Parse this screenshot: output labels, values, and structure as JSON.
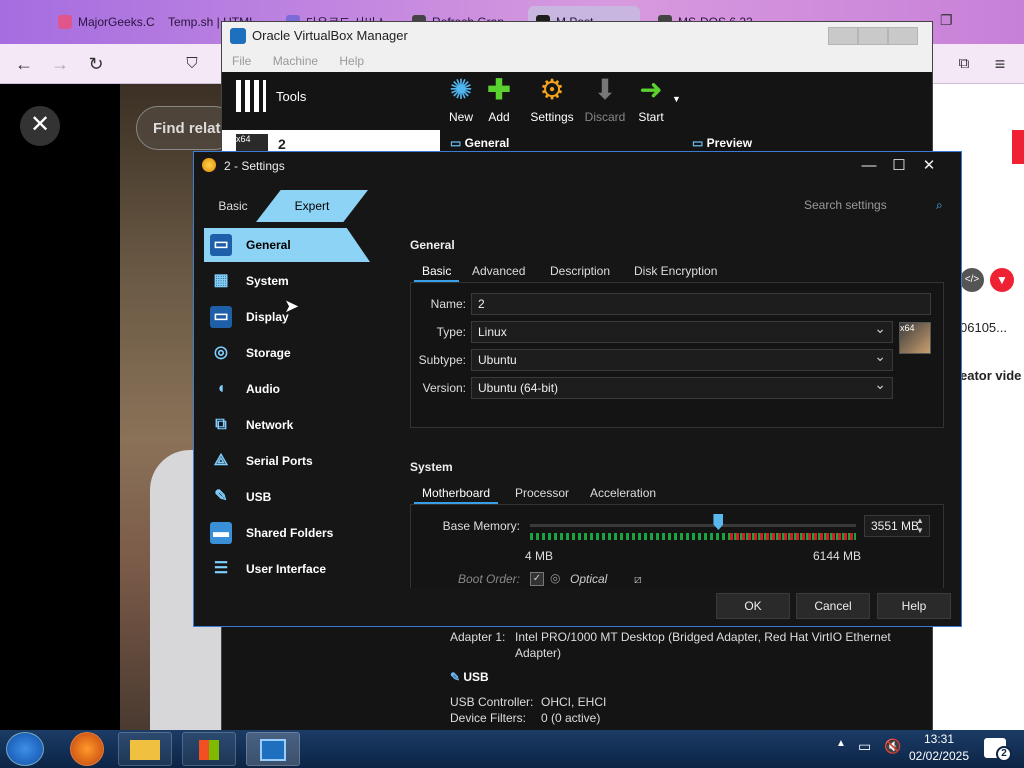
{
  "browser": {
    "tabs": [
      {
        "label": "MajorGeeks.C",
        "color": "#e0558c"
      },
      {
        "label": "Temp.sh | HTML",
        "color": "#666666"
      },
      {
        "label": "다운로드 서비스",
        "color": "#7b6bd6"
      },
      {
        "label": "Refresh Grap",
        "color": "#444444"
      },
      {
        "label": "M Post",
        "color": "#1e1e1e"
      },
      {
        "label": "MS-DOS 6.22",
        "color": "#444444"
      }
    ],
    "video_find_label": "Find relat",
    "right_snippets": {
      "id_text": "06105...",
      "creator": "eator vide"
    }
  },
  "vbm": {
    "title": "Oracle VirtualBox Manager",
    "menu": [
      "File",
      "Machine",
      "Help"
    ],
    "tools_label": "Tools",
    "toolbar": [
      {
        "label": "New",
        "icon": "new-icon"
      },
      {
        "label": "Add",
        "icon": "add-icon"
      },
      {
        "label": "Settings",
        "icon": "settings-icon"
      },
      {
        "label": "Discard",
        "icon": "discard-icon"
      },
      {
        "label": "Start",
        "icon": "start-icon"
      }
    ],
    "vm_name": "2",
    "sections": {
      "general": "General",
      "preview": "Preview",
      "usb": "USB"
    },
    "adapter_label": "Adapter 1:",
    "adapter_value_1": "Intel PRO/1000 MT Desktop (Bridged Adapter, Red Hat VirtIO Ethernet",
    "adapter_value_2": "Adapter)",
    "usb_controller_label": "USB Controller:",
    "usb_controller_value": "OHCI, EHCI",
    "device_filters_label": "Device Filters:",
    "device_filters_value": "0 (0 active)"
  },
  "settings": {
    "title": "2 - Settings",
    "mode_basic": "Basic",
    "mode_expert": "Expert",
    "search_placeholder": "Search settings",
    "nav": [
      {
        "label": "General",
        "icon": "general-icon",
        "selected": true
      },
      {
        "label": "System",
        "icon": "system-icon"
      },
      {
        "label": "Display",
        "icon": "display-icon"
      },
      {
        "label": "Storage",
        "icon": "storage-icon"
      },
      {
        "label": "Audio",
        "icon": "audio-icon"
      },
      {
        "label": "Network",
        "icon": "network-icon"
      },
      {
        "label": "Serial Ports",
        "icon": "serial-ports-icon"
      },
      {
        "label": "USB",
        "icon": "usb-icon"
      },
      {
        "label": "Shared Folders",
        "icon": "shared-folders-icon"
      },
      {
        "label": "User Interface",
        "icon": "user-interface-icon"
      }
    ],
    "general": {
      "heading": "General",
      "tabs": [
        "Basic",
        "Advanced",
        "Description",
        "Disk Encryption"
      ],
      "name_label": "Name:",
      "name_value": "2",
      "type_label": "Type:",
      "type_value": "Linux",
      "subtype_label": "Subtype:",
      "subtype_value": "Ubuntu",
      "version_label": "Version:",
      "version_value": "Ubuntu (64-bit)",
      "os_badge": "x64"
    },
    "system": {
      "heading": "System",
      "tabs": [
        "Motherboard",
        "Processor",
        "Acceleration"
      ],
      "base_memory_label": "Base Memory:",
      "memory_min": "4 MB",
      "memory_max": "6144 MB",
      "memory_value": "3551 MB",
      "memory_fraction": 0.578,
      "boot_order_label": "Boot Order:",
      "boot_item": "Optical"
    },
    "buttons": {
      "ok": "OK",
      "cancel": "Cancel",
      "help": "Help"
    }
  },
  "taskbar": {
    "time": "13:31",
    "date": "02/02/2025",
    "notification_count": "2"
  }
}
